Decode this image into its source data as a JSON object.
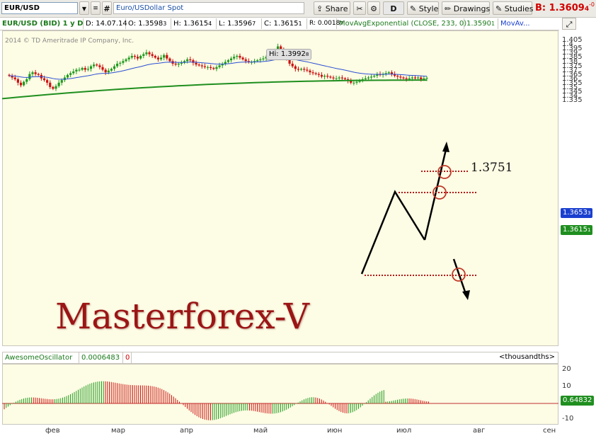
{
  "toolbar": {
    "symbol": "EUR/USD",
    "hash": "#",
    "description": "Euro/USDollar Spot",
    "share_label": "Share",
    "d_label": "D",
    "style_label": "Style",
    "drawings_label": "Drawings",
    "studies_label": "Studies",
    "bid_label": "B:",
    "bid_value": "1.3609",
    "bid_fraction": "4",
    "bid_change": "-0"
  },
  "infobar": {
    "series": "EUR/USD (BID) 1 y D",
    "date": "D: 14.07.14",
    "open": "O: 1.3598",
    "open_frac": "3",
    "high": "H: 1.3615",
    "high_frac": "4",
    "low": "L: 1.3596",
    "low_frac": "7",
    "close": "C: 1.3615",
    "close_frac": "1",
    "range": "R: 0.0018",
    "range_frac": "7",
    "study": "MovAvgExponential (CLOSE, 233, 0)",
    "study_value": "1.3590",
    "study_value_frac": "1",
    "study2": "MovAv..."
  },
  "chart": {
    "copyright": "2014 © TD Ameritrade IP Company, Inc.",
    "hi_label": "Hi: 1.3992",
    "hi_frac": "8",
    "annotation_level": "1.3751",
    "watermark": "Masterforex-V",
    "ema_price": "1.3653",
    "ema_price_frac": "3",
    "last_price": "1.3615",
    "last_price_frac": "1",
    "y_ticks": [
      "1.405",
      "1.4",
      "1.395",
      "1.39",
      "1.385",
      "1.38",
      "1.375",
      "1.37",
      "1.365",
      "1.36",
      "1.355",
      "1.35",
      "1.345",
      "1.34",
      "1.335"
    ],
    "x_ticks": [
      "фев",
      "мар",
      "апр",
      "май",
      "июн",
      "июл",
      "авг",
      "сен"
    ]
  },
  "oscillator": {
    "name": "AwesomeOscillator",
    "value": "0.0006483",
    "value2": "0",
    "units": "<thousandths>",
    "y_ticks": [
      "20",
      "10",
      "0",
      "-10"
    ],
    "current_value": "0.64832"
  },
  "chart_data": {
    "type": "candlestick",
    "symbol": "EUR/USD",
    "timeframe": "1 y D",
    "ylim": [
      1.335,
      1.405
    ],
    "x_labels": [
      "фев",
      "мар",
      "апр",
      "май",
      "июн",
      "июл",
      "авг",
      "сен"
    ],
    "last_bar": {
      "date": "14.07.14",
      "open": 1.35983,
      "high": 1.36154,
      "low": 1.35967,
      "close": 1.36151
    },
    "high_marker": 1.39928,
    "annotation_level": 1.3751,
    "ema233_last": 1.35901,
    "ema_short_last": 1.36533,
    "closes_approx": [
      1.364,
      1.362,
      1.36,
      1.356,
      1.353,
      1.357,
      1.36,
      1.366,
      1.368,
      1.366,
      1.365,
      1.361,
      1.359,
      1.356,
      1.351,
      1.349,
      1.352,
      1.356,
      1.359,
      1.362,
      1.365,
      1.367,
      1.369,
      1.371,
      1.371,
      1.373,
      1.371,
      1.372,
      1.375,
      1.377,
      1.376,
      1.374,
      1.371,
      1.368,
      1.37,
      1.372,
      1.375,
      1.378,
      1.379,
      1.381,
      1.383,
      1.385,
      1.387,
      1.386,
      1.384,
      1.387,
      1.389,
      1.391,
      1.389,
      1.387,
      1.385,
      1.383,
      1.385,
      1.388,
      1.384,
      1.381,
      1.378,
      1.377,
      1.378,
      1.379,
      1.381,
      1.383,
      1.382,
      1.379,
      1.377,
      1.376,
      1.375,
      1.374,
      1.374,
      1.373,
      1.372,
      1.374,
      1.376,
      1.378,
      1.38,
      1.382,
      1.384,
      1.386,
      1.387,
      1.385,
      1.383,
      1.381,
      1.38,
      1.38,
      1.381,
      1.382,
      1.383,
      1.384,
      1.386,
      1.388,
      1.391,
      1.393,
      1.398,
      1.394,
      1.388,
      1.383,
      1.378,
      1.375,
      1.372,
      1.371,
      1.372,
      1.371,
      1.37,
      1.368,
      1.367,
      1.366,
      1.365,
      1.363,
      1.364,
      1.363,
      1.362,
      1.361,
      1.361,
      1.362,
      1.361,
      1.36,
      1.358,
      1.356,
      1.356,
      1.357,
      1.359,
      1.36,
      1.361,
      1.362,
      1.363,
      1.364,
      1.366,
      1.365,
      1.366,
      1.367,
      1.368,
      1.366,
      1.364,
      1.363,
      1.362,
      1.361,
      1.36,
      1.361,
      1.362,
      1.361,
      1.362,
      1.36,
      1.361,
      1.3615
    ],
    "oscillator": {
      "name": "AwesomeOscillator",
      "current": 0.64832,
      "ylim": [
        -12,
        22
      ]
    }
  }
}
